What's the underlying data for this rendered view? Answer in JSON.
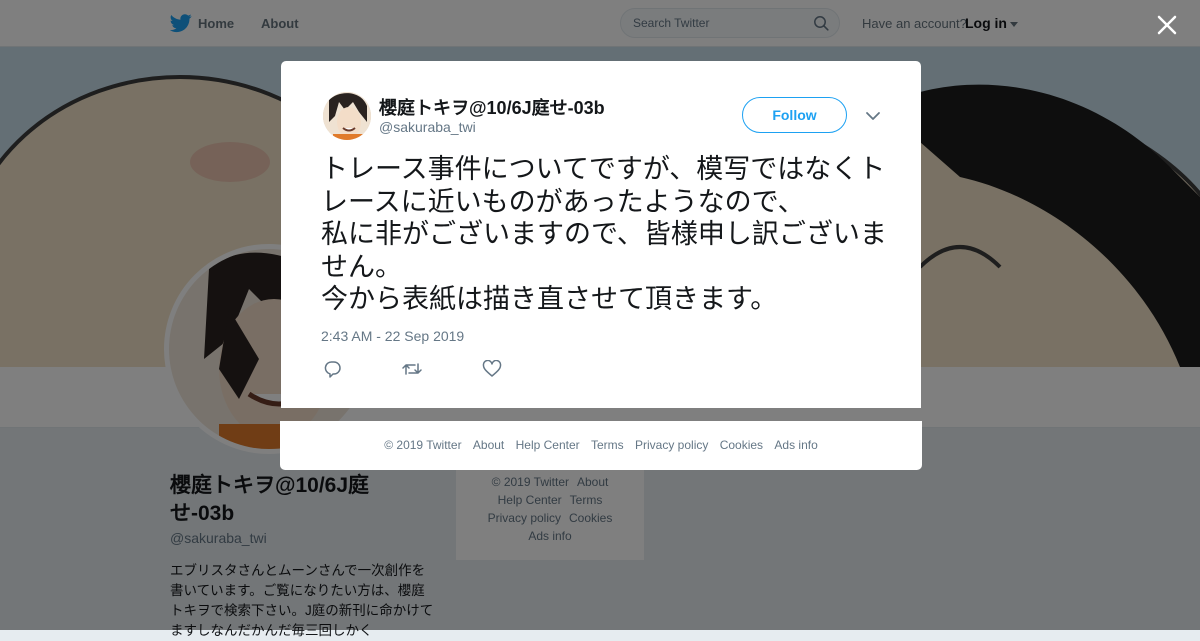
{
  "topbar": {
    "home_label": "Home",
    "about_label": "About",
    "search_placeholder": "Search Twitter",
    "have_account": "Have an account?",
    "login_label": "Log in"
  },
  "profile": {
    "name": "櫻庭トキヲ@10/6J庭せ-03b",
    "handle": "@sakuraba_twi",
    "bio": "エブリスタさんとムーンさんで一次創作を書いています。ご覧になりたい方は、櫻庭トキヲで検索下さい。J庭の新刊に命かけてますしなんだかんだ毎三回しかく"
  },
  "side_footer": {
    "items": [
      "© 2019 Twitter",
      "About",
      "Help Center",
      "Terms",
      "Privacy policy",
      "Cookies",
      "Ads info"
    ]
  },
  "tweet": {
    "author_name": "櫻庭トキヲ@10/6J庭せ-03b",
    "author_handle": "@sakuraba_twi",
    "follow_label": "Follow",
    "text": "トレース事件についてですが、模写ではなくトレースに近いものがあったようなので、\n私に非がございますので、皆様申し訳ございません。\n今から表紙は描き直させて頂きます。",
    "timestamp": "2:43 AM - 22 Sep 2019"
  },
  "modal_footer": {
    "items": [
      "© 2019 Twitter",
      "About",
      "Help Center",
      "Terms",
      "Privacy policy",
      "Cookies",
      "Ads info"
    ]
  },
  "colors": {
    "accent": "#1da1f2",
    "text_secondary": "#657786",
    "overlay": "rgba(0,0,0,0.5)"
  },
  "icons": [
    "twitter-bird-icon",
    "search-icon",
    "caret-down-icon",
    "close-icon",
    "chevron-down-icon",
    "reply-icon",
    "retweet-icon",
    "like-icon"
  ]
}
